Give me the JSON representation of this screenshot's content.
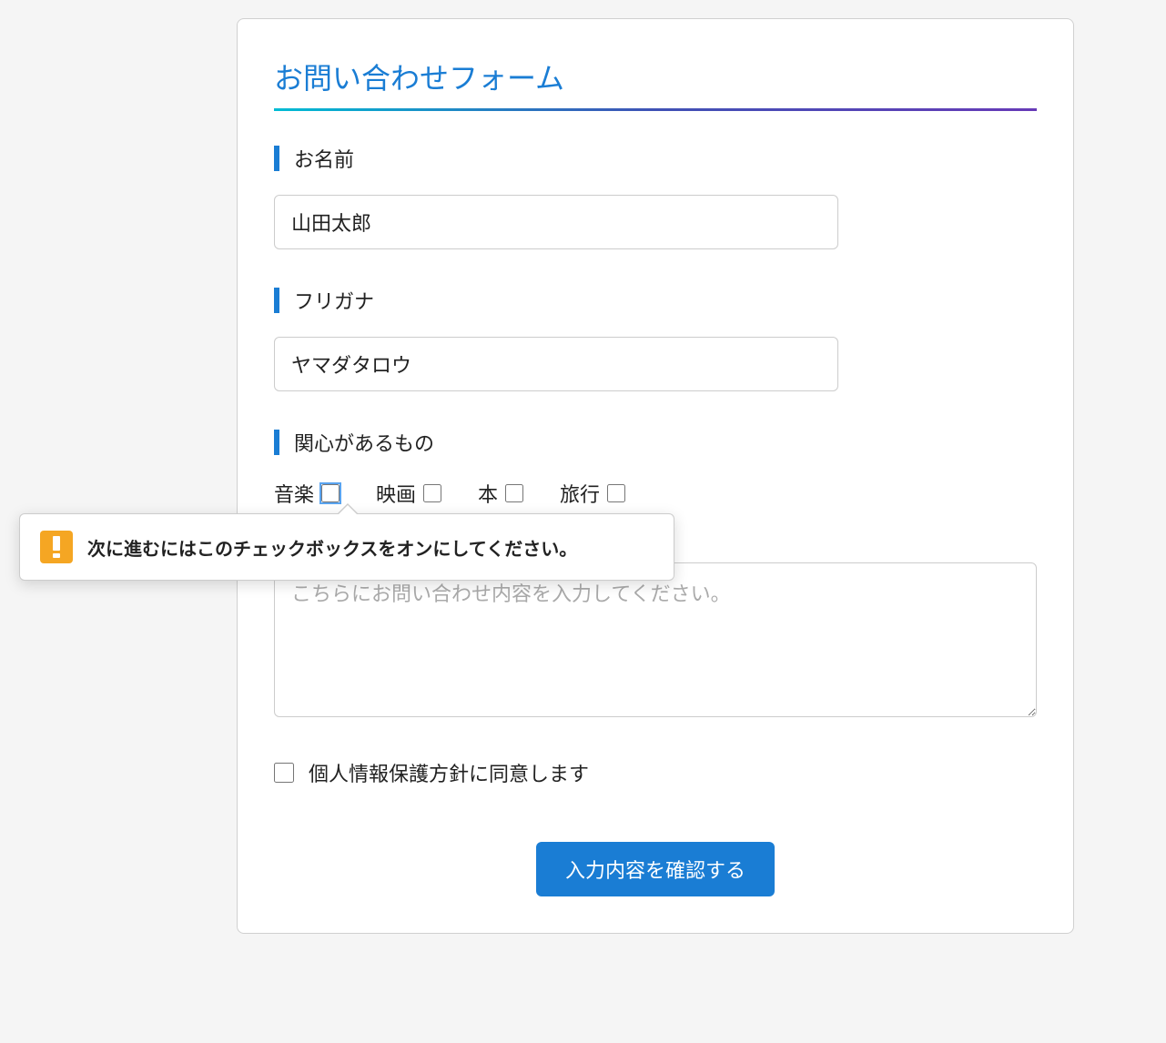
{
  "form": {
    "title": "お問い合わせフォーム",
    "fields": {
      "name": {
        "label": "お名前",
        "value": "山田太郎"
      },
      "furigana": {
        "label": "フリガナ",
        "value": "ヤマダタロウ"
      },
      "interests": {
        "label": "関心があるもの",
        "options": [
          {
            "label": "音楽",
            "checked": false,
            "highlighted": true
          },
          {
            "label": "映画",
            "checked": false,
            "highlighted": false
          },
          {
            "label": "本",
            "checked": false,
            "highlighted": false
          },
          {
            "label": "旅行",
            "checked": false,
            "highlighted": false
          }
        ]
      },
      "message": {
        "placeholder": "こちらにお問い合わせ内容を入力してください。",
        "value": ""
      },
      "agree": {
        "label": "個人情報保護方針に同意します",
        "checked": false
      }
    },
    "submit_label": "入力内容を確認する"
  },
  "tooltip": {
    "text": "次に進むにはこのチェックボックスをオンにしてください。"
  }
}
